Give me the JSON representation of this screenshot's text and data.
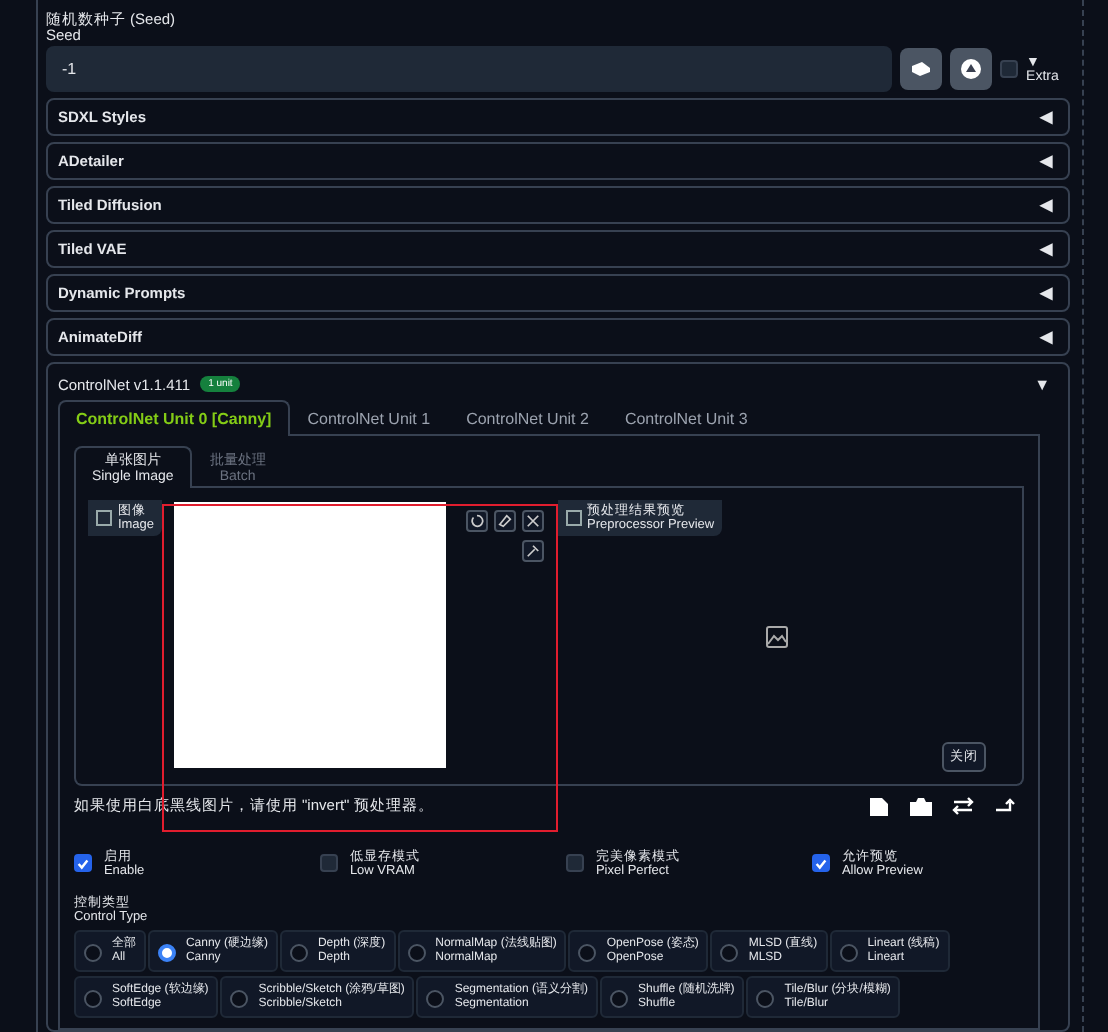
{
  "seed": {
    "label_cn": "随机数种子 (Seed)",
    "label_en": "Seed",
    "value": "-1",
    "extra": {
      "label": "Extra",
      "arrow": "▼",
      "checked": false
    }
  },
  "accordions": [
    {
      "title": "SDXL Styles",
      "arrow": "◀"
    },
    {
      "title": "ADetailer",
      "arrow": "◀"
    },
    {
      "title": "Tiled Diffusion",
      "arrow": "◀"
    },
    {
      "title": "Tiled VAE",
      "arrow": "◀"
    },
    {
      "title": "Dynamic Prompts",
      "arrow": "◀"
    },
    {
      "title": "AnimateDiff",
      "arrow": "◀"
    }
  ],
  "controlnet": {
    "title": "ControlNet v1.1.411",
    "badge": "1 unit",
    "arrow": "▼",
    "tabs": [
      {
        "label": "ControlNet Unit 0 [Canny]",
        "selected": true
      },
      {
        "label": "ControlNet Unit 1",
        "selected": false
      },
      {
        "label": "ControlNet Unit 2",
        "selected": false
      },
      {
        "label": "ControlNet Unit 3",
        "selected": false
      }
    ],
    "subtabs": [
      {
        "label": "单张图片",
        "sublabel": "Single Image",
        "selected": true
      },
      {
        "label": "批量处理",
        "sublabel": "Batch",
        "selected": false
      }
    ],
    "image_label": {
      "cn": "图像",
      "en": "Image"
    },
    "preview_label": {
      "cn": "预处理结果预览",
      "en": "Preprocessor Preview"
    },
    "close_button": "关闭",
    "hint": "如果使用白底黑线图片，请使用 \"invert\" 预处理器。",
    "options": [
      {
        "cn": "启用",
        "en": "Enable",
        "checked": true
      },
      {
        "cn": "低显存模式",
        "en": "Low VRAM",
        "checked": false
      },
      {
        "cn": "完美像素模式",
        "en": "Pixel Perfect",
        "checked": false
      },
      {
        "cn": "允许预览",
        "en": "Allow Preview",
        "checked": true
      }
    ],
    "control_type": {
      "cn": "控制类型",
      "en": "Control Type"
    },
    "types": [
      {
        "cn": "全部",
        "en": "All",
        "selected": false
      },
      {
        "cn": "Canny (硬边缘)",
        "en": "Canny",
        "selected": true
      },
      {
        "cn": "Depth (深度)",
        "en": "Depth",
        "selected": false
      },
      {
        "cn": "NormalMap (法线贴图)",
        "en": "NormalMap",
        "selected": false
      },
      {
        "cn": "OpenPose (姿态)",
        "en": "OpenPose",
        "selected": false
      },
      {
        "cn": "MLSD (直线)",
        "en": "MLSD",
        "selected": false
      },
      {
        "cn": "Lineart (线稿)",
        "en": "Lineart",
        "selected": false
      },
      {
        "cn": "SoftEdge (软边缘)",
        "en": "SoftEdge",
        "selected": false
      },
      {
        "cn": "Scribble/Sketch (涂鸦/草图)",
        "en": "Scribble/Sketch",
        "selected": false
      },
      {
        "cn": "Segmentation (语义分割)",
        "en": "Segmentation",
        "selected": false
      },
      {
        "cn": "Shuffle (随机洗牌)",
        "en": "Shuffle",
        "selected": false
      },
      {
        "cn": "Tile/Blur (分块/模糊)",
        "en": "Tile/Blur",
        "selected": false
      }
    ]
  }
}
